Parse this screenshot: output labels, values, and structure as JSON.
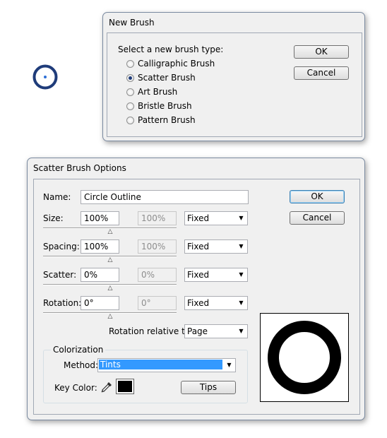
{
  "canvas_symbol": {
    "icon": "circle-outline-brush-swatch-icon",
    "color": "#1f3c7a",
    "center_color": "#2d6fd6"
  },
  "new_brush_dialog": {
    "title": "New Brush",
    "prompt": "Select a new brush type:",
    "options": [
      {
        "label": "Calligraphic Brush",
        "checked": false
      },
      {
        "label": "Scatter Brush",
        "checked": true
      },
      {
        "label": "Art Brush",
        "checked": false
      },
      {
        "label": "Bristle Brush",
        "checked": false
      },
      {
        "label": "Pattern Brush",
        "checked": false
      }
    ],
    "ok_label": "OK",
    "cancel_label": "Cancel"
  },
  "scatter_dialog": {
    "title": "Scatter Brush Options",
    "name_label": "Name:",
    "name_value": "Circle Outline",
    "ok_label": "OK",
    "cancel_label": "Cancel",
    "rows": [
      {
        "label": "Size:",
        "value": "100%",
        "value2": "100%",
        "mode": "Fixed"
      },
      {
        "label": "Spacing:",
        "value": "100%",
        "value2": "100%",
        "mode": "Fixed"
      },
      {
        "label": "Scatter:",
        "value": "0%",
        "value2": "0%",
        "mode": "Fixed"
      },
      {
        "label": "Rotation:",
        "value": "0°",
        "value2": "0°",
        "mode": "Fixed"
      }
    ],
    "rotation_relative_label": "Rotation relative to:",
    "rotation_relative_value": "Page",
    "colorization": {
      "legend": "Colorization",
      "method_label": "Method:",
      "method_value": "Tints",
      "method_highlight": "#3399ff",
      "key_color_label": "Key Color:",
      "key_color": "#000000",
      "eyedropper_icon": "eyedropper-icon",
      "tips_label": "Tips"
    },
    "preview": {
      "shape": "ring",
      "stroke_color": "#000000"
    }
  }
}
